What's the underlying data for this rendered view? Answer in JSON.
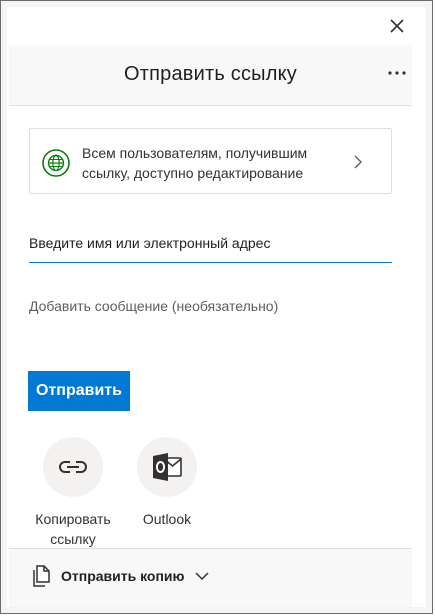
{
  "dialog": {
    "title": "Отправить ссылку"
  },
  "link_settings": {
    "description": "Всем пользователям, получившим ссылку, доступно редактирование"
  },
  "recipient": {
    "placeholder": "Введите имя или электронный адрес",
    "value": ""
  },
  "message": {
    "placeholder": "Добавить сообщение (необязательно)",
    "value": ""
  },
  "send_button": {
    "label": "Отправить"
  },
  "share_options": [
    {
      "label": "Копировать ссылку",
      "icon": "link-icon"
    },
    {
      "label": "Outlook",
      "icon": "outlook-icon"
    }
  ],
  "footer": {
    "send_copy_label": "Отправить копию",
    "icon": "copy-document-icon"
  },
  "colors": {
    "accent": "#0078d4",
    "globe": "#107c10",
    "outlook": "#0078d4"
  },
  "icons": {
    "close": "close-icon",
    "more": "more-options-icon",
    "globe": "globe-icon",
    "chevron": "chevron-right-icon",
    "dropdown": "chevron-down-icon"
  }
}
